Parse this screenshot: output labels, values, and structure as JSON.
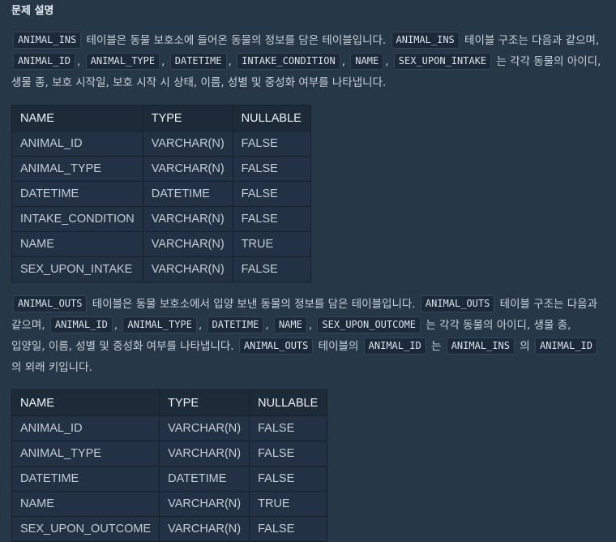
{
  "section_title": "문제 설명",
  "para1": [
    {
      "code": "ANIMAL_INS"
    },
    {
      "text": " 테이블은 동물 보호소에 들어온 동물의 정보를 담은 테이블입니다. "
    },
    {
      "code": "ANIMAL_INS"
    },
    {
      "text": " 테이블 구조는 다음과 같으며, "
    },
    {
      "code": "ANIMAL_ID"
    },
    {
      "text": ", "
    },
    {
      "code": "ANIMAL_TYPE"
    },
    {
      "text": ", "
    },
    {
      "code": "DATETIME"
    },
    {
      "text": ", "
    },
    {
      "code": "INTAKE_CONDITION"
    },
    {
      "text": ", "
    },
    {
      "code": "NAME"
    },
    {
      "text": ", "
    },
    {
      "code": "SEX_UPON_INTAKE"
    },
    {
      "text": " 는 각각 동물의 아이디, 생물 종, 보호 시작일, 보호 시작 시 상태, 이름, 성별 및 중성화 여부를 나타냅니다."
    }
  ],
  "table1": {
    "headers": [
      "NAME",
      "TYPE",
      "NULLABLE"
    ],
    "rows": [
      [
        "ANIMAL_ID",
        "VARCHAR(N)",
        "FALSE"
      ],
      [
        "ANIMAL_TYPE",
        "VARCHAR(N)",
        "FALSE"
      ],
      [
        "DATETIME",
        "DATETIME",
        "FALSE"
      ],
      [
        "INTAKE_CONDITION",
        "VARCHAR(N)",
        "FALSE"
      ],
      [
        "NAME",
        "VARCHAR(N)",
        "TRUE"
      ],
      [
        "SEX_UPON_INTAKE",
        "VARCHAR(N)",
        "FALSE"
      ]
    ]
  },
  "para2": [
    {
      "code": "ANIMAL_OUTS"
    },
    {
      "text": " 테이블은 동물 보호소에서 입양 보낸 동물의 정보를 담은 테이블입니다. "
    },
    {
      "code": "ANIMAL_OUTS"
    },
    {
      "text": " 테이블 구조는 다음과 같으며, "
    },
    {
      "code": "ANIMAL_ID"
    },
    {
      "text": ", "
    },
    {
      "code": "ANIMAL_TYPE"
    },
    {
      "text": ", "
    },
    {
      "code": "DATETIME"
    },
    {
      "text": ", "
    },
    {
      "code": "NAME"
    },
    {
      "text": ", "
    },
    {
      "code": "SEX_UPON_OUTCOME"
    },
    {
      "text": " 는 각각 동물의 아이디, 생물 종, 입양일, 이름, 성별 및 중성화 여부를 나타냅니다. "
    },
    {
      "code": "ANIMAL_OUTS"
    },
    {
      "text": " 테이블의 "
    },
    {
      "code": "ANIMAL_ID"
    },
    {
      "text": " 는 "
    },
    {
      "code": "ANIMAL_INS"
    },
    {
      "text": " 의 "
    },
    {
      "code": "ANIMAL_ID"
    },
    {
      "text": " 의 외래 키입니다."
    }
  ],
  "table2": {
    "headers": [
      "NAME",
      "TYPE",
      "NULLABLE"
    ],
    "rows": [
      [
        "ANIMAL_ID",
        "VARCHAR(N)",
        "FALSE"
      ],
      [
        "ANIMAL_TYPE",
        "VARCHAR(N)",
        "FALSE"
      ],
      [
        "DATETIME",
        "DATETIME",
        "FALSE"
      ],
      [
        "NAME",
        "VARCHAR(N)",
        "TRUE"
      ],
      [
        "SEX_UPON_OUTCOME",
        "VARCHAR(N)",
        "FALSE"
      ]
    ]
  }
}
